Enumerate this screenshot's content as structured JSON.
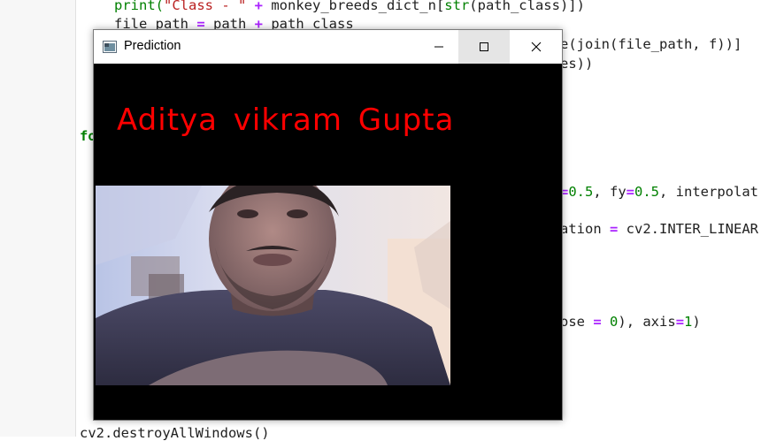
{
  "window": {
    "title": "Prediction",
    "prediction_label": "Aditya vikram Gupta"
  },
  "code": {
    "line1": {
      "a": "print(",
      "b": "\"Class - \"",
      "c": " + ",
      "d": "monkey_breeds_dict_n[",
      "e": "str",
      "f": "(path_class)])"
    },
    "line2": {
      "a": "file_path ",
      "b": "=",
      "c": " path ",
      "d": "+",
      "e": " path_class"
    },
    "line3": "e(join(file_path, f))]",
    "line4": "es))",
    "line5": "fo",
    "line6": {
      "a": "=",
      "b": "0.5",
      "c": ", fy",
      "d": "=",
      "e": "0.5",
      "f": ", interpolat"
    },
    "line7": {
      "a": "ation ",
      "b": "=",
      "c": " cv2.INTER_LINEAR"
    },
    "line8": {
      "a": "ose ",
      "b": "=",
      "c": " ",
      "d": "0",
      "e": "), axis",
      "f": "=",
      "g": "1",
      "h": ")"
    },
    "line9": "cv2.destroyAllWindows()"
  },
  "icons": {
    "app": "window-app-icon",
    "minimize": "minimize-icon",
    "maximize": "maximize-icon",
    "close": "close-icon"
  }
}
